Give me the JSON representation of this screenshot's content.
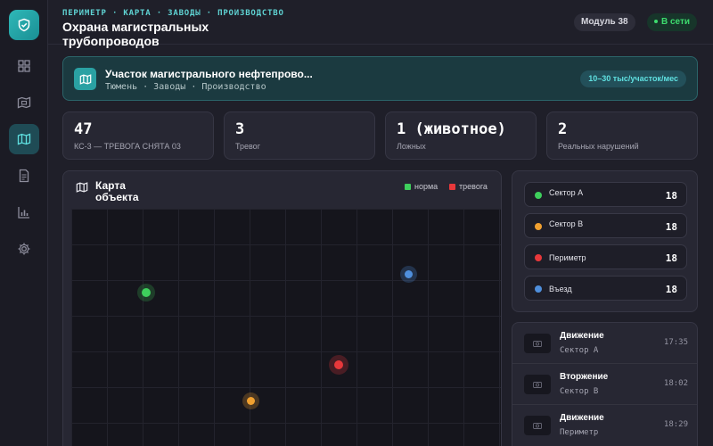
{
  "header": {
    "breadcrumb": "ПЕРИМЕТР · КАРТА · ЗАВОДЫ · ПРОИЗВОДСТВО",
    "title": "Охрана магистральных трубопроводов",
    "module": "Модуль 38",
    "status": "В сети"
  },
  "sidebar": {
    "items": [
      {
        "icon": "dashboard-icon"
      },
      {
        "icon": "camera-map-icon"
      },
      {
        "icon": "map-icon",
        "active": true
      },
      {
        "icon": "document-icon"
      },
      {
        "icon": "bar-chart-icon"
      },
      {
        "icon": "gear-icon"
      }
    ]
  },
  "banner": {
    "title": "Участок магистрального нефтепрово...",
    "subtitle": "Тюмень · Заводы · Производство",
    "rate": "10–30 тыс/участок/мес"
  },
  "stats": [
    {
      "value": "47",
      "label": "КС-3 — ТРЕВОГА СНЯТА 03"
    },
    {
      "value": "3",
      "label": "Тревог"
    },
    {
      "value": "1 (животное)",
      "label": "Ложных"
    },
    {
      "value": "2",
      "label": "Реальных нарушений"
    }
  ],
  "map": {
    "title": "Карта объекта",
    "legend": {
      "normal": "норма",
      "alarm": "тревога"
    },
    "sensors": [
      {
        "color": "#3ecf5c",
        "state": "normal"
      },
      {
        "color": "#4f8fdc",
        "state": "normal"
      },
      {
        "color": "#e8383b",
        "state": "alarm"
      },
      {
        "color": "#f0a030",
        "state": "normal"
      }
    ]
  },
  "sectors": [
    {
      "name": "Сектор А",
      "count": "18",
      "color": "#3ecf5c"
    },
    {
      "name": "Сектор В",
      "count": "18",
      "color": "#f0a030"
    },
    {
      "name": "Периметр",
      "count": "18",
      "color": "#e8383b"
    },
    {
      "name": "Въезд",
      "count": "18",
      "color": "#4f8fdc"
    }
  ],
  "events": [
    {
      "title": "Движение",
      "place": "Сектор А",
      "time": "17:35"
    },
    {
      "title": "Вторжение",
      "place": "Сектор В",
      "time": "18:02"
    },
    {
      "title": "Движение",
      "place": "Периметр",
      "time": "18:29"
    }
  ],
  "colors": {
    "accent": "#2fb8b8",
    "normal": "#3ecf5c",
    "alarm": "#e8383b"
  }
}
